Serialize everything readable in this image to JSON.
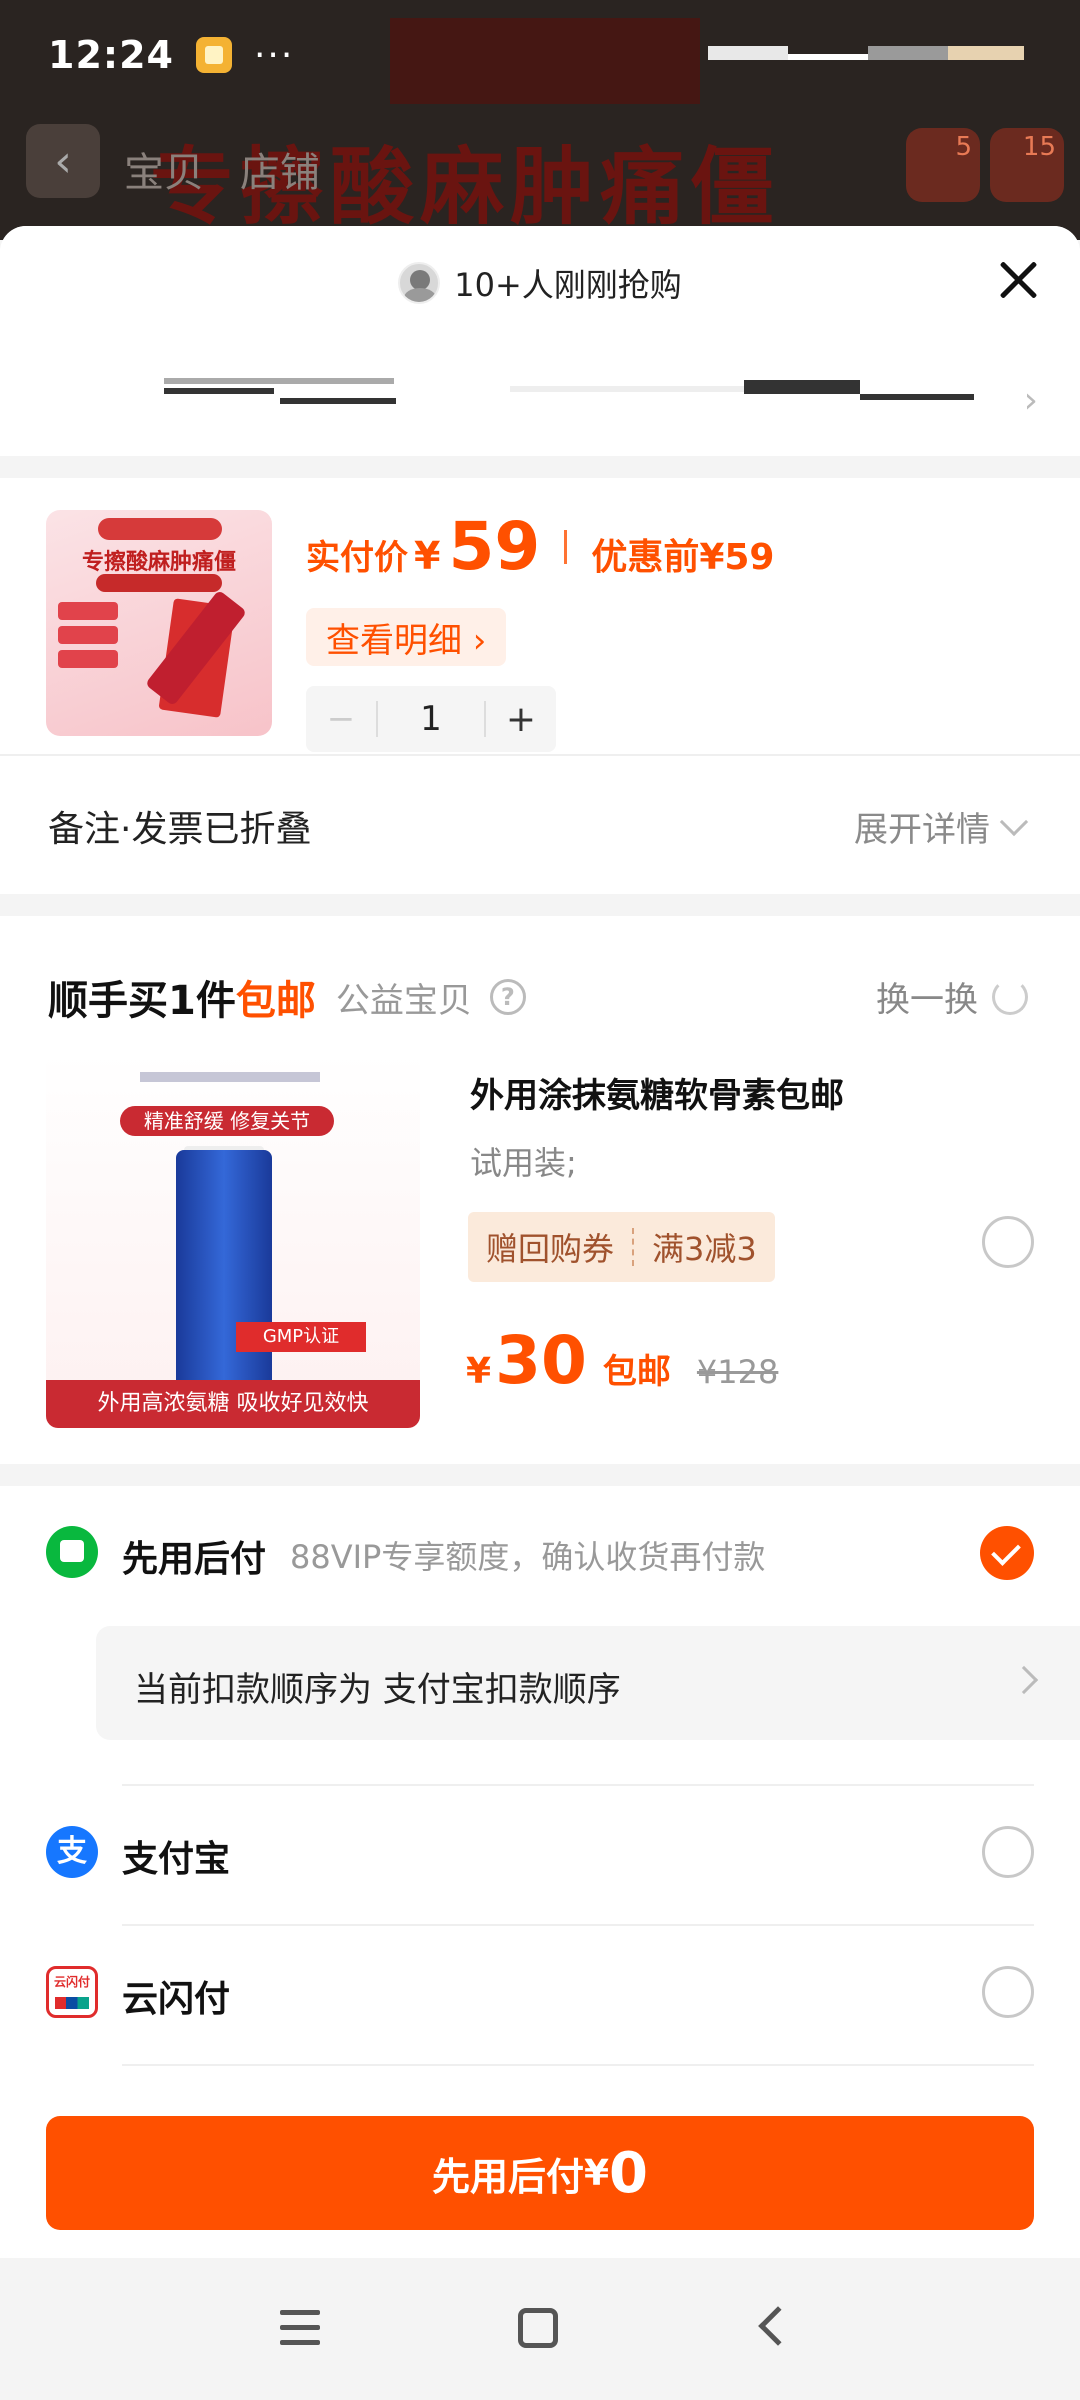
{
  "status_bar": {
    "time": "12:24",
    "more": "···"
  },
  "background_app": {
    "banner_text": "专擦酸麻肿痛僵",
    "tabs": [
      "宝贝",
      "店铺"
    ],
    "cart_count": "5",
    "message_count": "15"
  },
  "sheet": {
    "social_proof": "10+人刚刚抢购"
  },
  "product": {
    "thumb_title": "专擦酸麻肿痛僵",
    "price_label": "实付价",
    "currency": "¥",
    "price": "59",
    "before_label": "优惠前¥59",
    "detail_button": "查看明细 ›",
    "quantity": "1",
    "minus": "−",
    "plus": "+"
  },
  "note": {
    "label": "备注·发票已折叠",
    "expand": "展开详情"
  },
  "addon": {
    "title_main": "顺手买1件",
    "title_highlight": "包邮",
    "title_tag": "公益宝贝",
    "help": "?",
    "swap": "换一换",
    "thumb_tag": "精准舒缓 修复关节",
    "thumb_badge": "GMP认证",
    "thumb_footer": "外用高浓氨糖 吸收好见效快",
    "name": "外用涂抹氨糖软骨素包邮",
    "spec": "试用装;",
    "coupon_1": "赠回购券",
    "coupon_2": "满3减3",
    "currency": "¥",
    "price": "30",
    "free_shipping": "包邮",
    "original_price": "¥128"
  },
  "payment": {
    "later_title": "先用后付",
    "later_sub": "88VIP专享额度，确认收货再付款",
    "deduct_text": "当前扣款顺序为 支付宝扣款顺序",
    "alipay": "支付宝",
    "unionpay": "云闪付"
  },
  "submit": {
    "label": "先用后付",
    "currency": "¥",
    "amount": "0"
  },
  "colors": {
    "accent": "#ff5000",
    "alipay": "#1677ff",
    "later": "#09b83e"
  }
}
